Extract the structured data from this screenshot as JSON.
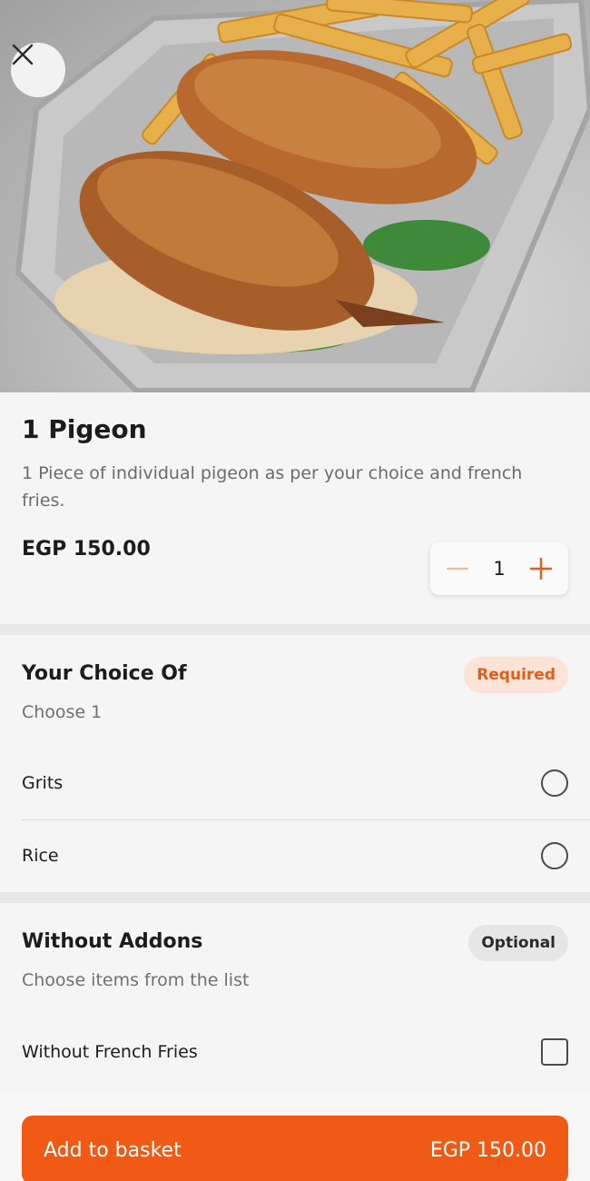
{
  "product": {
    "title": "1 Pigeon",
    "description": "1 Piece of individual pigeon as per your choice and french fries.",
    "price": "EGP 150.00",
    "quantity": "1"
  },
  "choice_group": {
    "title": "Your Choice Of",
    "badge": "Required",
    "subtitle": "Choose 1",
    "options": [
      {
        "label": "Grits"
      },
      {
        "label": "Rice"
      }
    ]
  },
  "addons_group": {
    "title": "Without Addons",
    "badge": "Optional",
    "subtitle": "Choose items from the list",
    "options": [
      {
        "label": "Without French Fries"
      }
    ]
  },
  "footer": {
    "add_label": "Add to basket",
    "total": "EGP 150.00"
  },
  "colors": {
    "accent": "#f05a14",
    "required_bg": "#fbe3d6",
    "required_text": "#e35d18"
  },
  "icons": {
    "close": "close-icon",
    "minus": "minus-icon",
    "plus": "plus-icon"
  }
}
